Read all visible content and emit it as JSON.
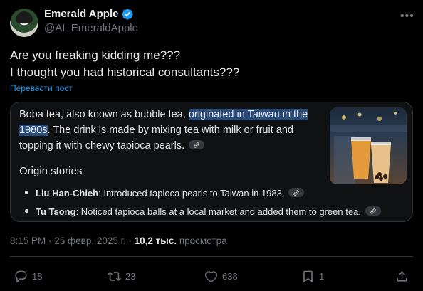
{
  "author": {
    "name": "Emerald Apple",
    "handle": "@AI_EmeraldApple"
  },
  "tweet": {
    "lines": [
      "Are you freaking kidding me???",
      "I thought you had historical consultants???"
    ],
    "translate_label": "Перевести пост"
  },
  "card": {
    "para_start": "Boba tea, also known as bubble tea, ",
    "para_highlight": "originated in Taiwan in the 1980s",
    "para_end": ". The drink is made by mixing tea with milk or fruit and topping it with chewy tapioca pearls.",
    "origin_heading": "Origin stories",
    "bullets": [
      {
        "name": "Liu Han-Chieh",
        "text": ": Introduced tapioca pearls to Taiwan in 1983."
      },
      {
        "name": "Tu Tsong",
        "text": ": Noticed tapioca balls at a local market and added them to green tea."
      }
    ]
  },
  "meta": {
    "time_date": "8:15 PM · 25 февр. 2025 г. · ",
    "views_count": "10,2 тыс.",
    "views_label": " просмотра"
  },
  "actions": {
    "replies": "18",
    "reposts": "23",
    "likes": "638",
    "bookmarks": "1"
  },
  "colors": {
    "accent": "#1d9bf0",
    "muted": "#71767b",
    "highlight": "#2a4a7a"
  },
  "icons": [
    "verified-badge-icon",
    "more-icon",
    "link-icon",
    "reply-icon",
    "repost-icon",
    "like-icon",
    "bookmark-icon",
    "share-icon"
  ]
}
